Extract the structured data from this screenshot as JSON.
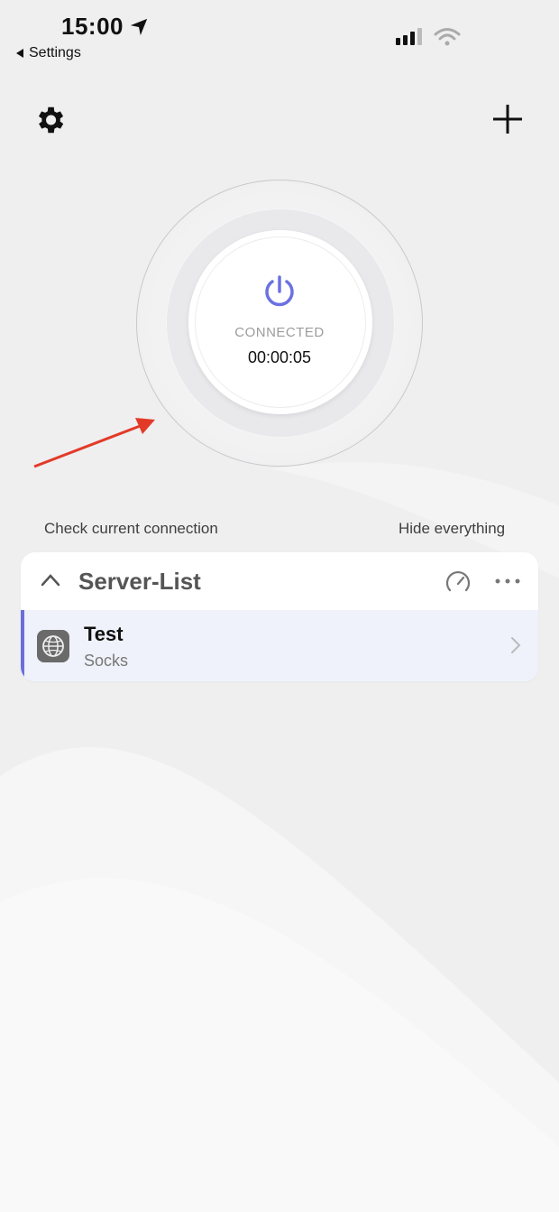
{
  "status_bar": {
    "time": "15:00",
    "back_label": "Settings"
  },
  "connection": {
    "status": "CONNECTED",
    "timer": "00:00:05"
  },
  "links": {
    "check_connection": "Check current connection",
    "hide_everything": "Hide everything"
  },
  "server_list": {
    "title": "Server-List",
    "items": [
      {
        "name": "Test",
        "type": "Socks"
      }
    ]
  },
  "colors": {
    "accent": "#6b6fd6",
    "power_icon": "#6b72e0",
    "annotation_arrow": "#e33a28"
  },
  "icons": [
    "location-arrow-icon",
    "back-icon",
    "signal-icon",
    "wifi-icon",
    "gear-icon",
    "plus-icon",
    "power-icon",
    "chevron-up-icon",
    "speedometer-icon",
    "more-icon",
    "globe-icon",
    "chevron-right-icon"
  ]
}
